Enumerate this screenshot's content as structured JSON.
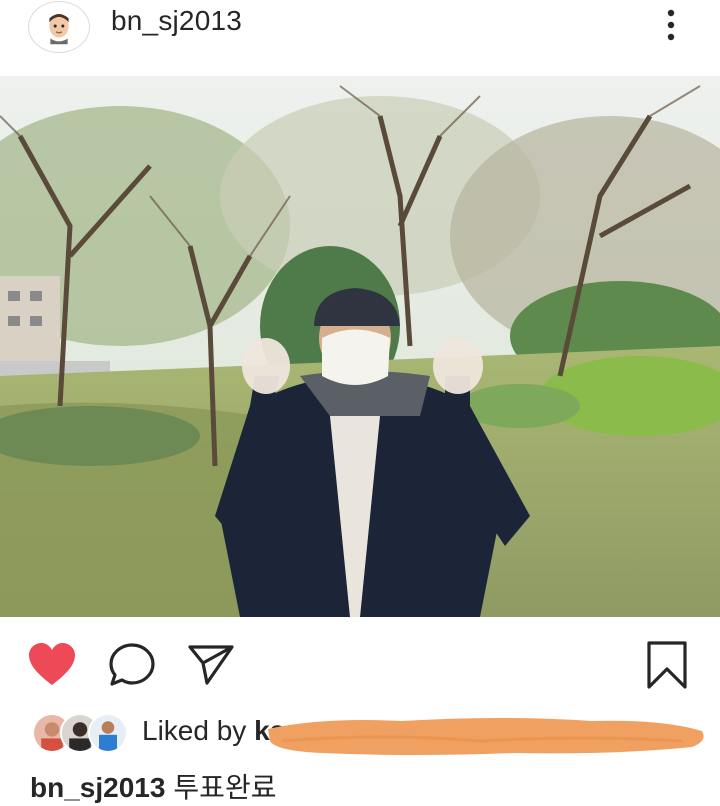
{
  "post": {
    "username": "bn_sj2013",
    "avatar_icon": "memoji-avatar-icon",
    "more_icon": "more-vertical-icon"
  },
  "actions": {
    "like_icon": "heart-filled-icon",
    "like_color": "#ed4956",
    "comment_icon": "comment-icon",
    "share_icon": "send-icon",
    "save_icon": "bookmark-icon"
  },
  "likes": {
    "prefix": "Liked by",
    "first_user": "ka",
    "redaction_color": "#f0a060"
  },
  "caption": {
    "username": "bn_sj2013",
    "text": "투표완료"
  }
}
